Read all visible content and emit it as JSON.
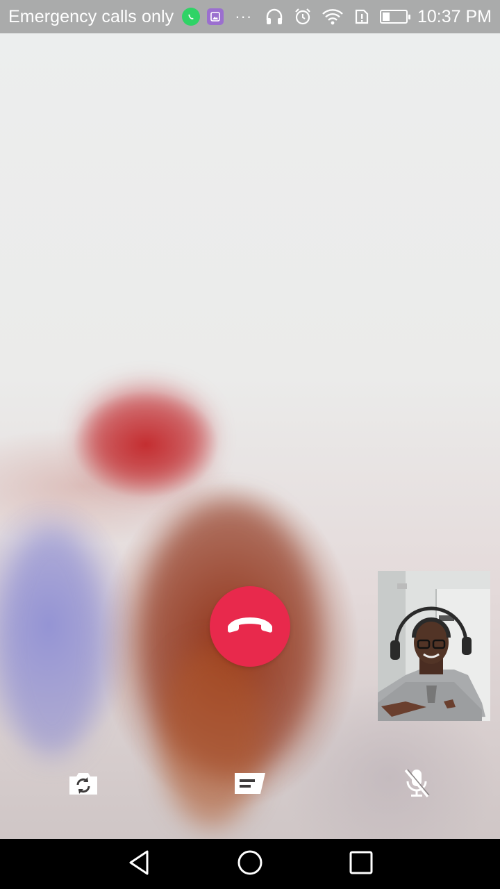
{
  "status_bar": {
    "carrier": "Emergency calls only",
    "more": "···",
    "time": "10:37 PM",
    "battery_level": 0.3,
    "icons": [
      "whatsapp-icon",
      "gallery-icon",
      "headphones-icon",
      "alarm-icon",
      "wifi-icon",
      "sim-alert-icon",
      "battery-icon"
    ]
  },
  "call": {
    "end_call_color": "#e8294c",
    "controls": [
      "switch-camera-icon",
      "message-icon",
      "mute-mic-icon"
    ]
  },
  "nav_bar": {
    "buttons": [
      "back-icon",
      "home-icon",
      "recents-icon"
    ]
  }
}
